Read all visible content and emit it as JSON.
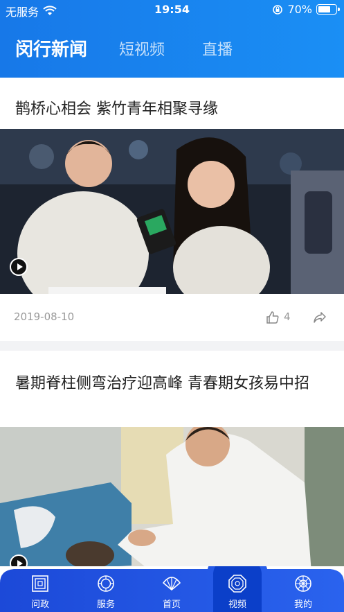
{
  "status_bar": {
    "carrier": "无服务",
    "time": "19:54",
    "battery_pct": "70%",
    "battery_level": 0.7
  },
  "header": {
    "tabs": [
      {
        "label": "闵行新闻",
        "active": true
      },
      {
        "label": "短视频",
        "active": false
      },
      {
        "label": "直播",
        "active": false
      }
    ]
  },
  "feed": {
    "articles": [
      {
        "title": "鹊桥心相会 紫竹青年相聚寻缘",
        "date": "2019-08-10",
        "likes": "4",
        "icons": [
          "play-icon",
          "thumb-up-icon",
          "share-icon"
        ]
      },
      {
        "title": "暑期脊柱侧弯治疗迎高峰 青春期女孩易中招",
        "icons": [
          "play-icon"
        ]
      }
    ]
  },
  "bottom_nav": {
    "items": [
      {
        "label": "问政",
        "icon": "window-icon"
      },
      {
        "label": "服务",
        "icon": "medallion-icon"
      },
      {
        "label": "首页",
        "icon": "fan-icon"
      },
      {
        "label": "视频",
        "icon": "octagon-icon",
        "active": true
      },
      {
        "label": "我的",
        "icon": "lattice-icon"
      }
    ]
  },
  "colors": {
    "header_blue": "#1a8ff5",
    "nav_blue": "#2058e6",
    "nav_active": "#0b3fc9",
    "meta_gray": "#9a9a9a"
  }
}
